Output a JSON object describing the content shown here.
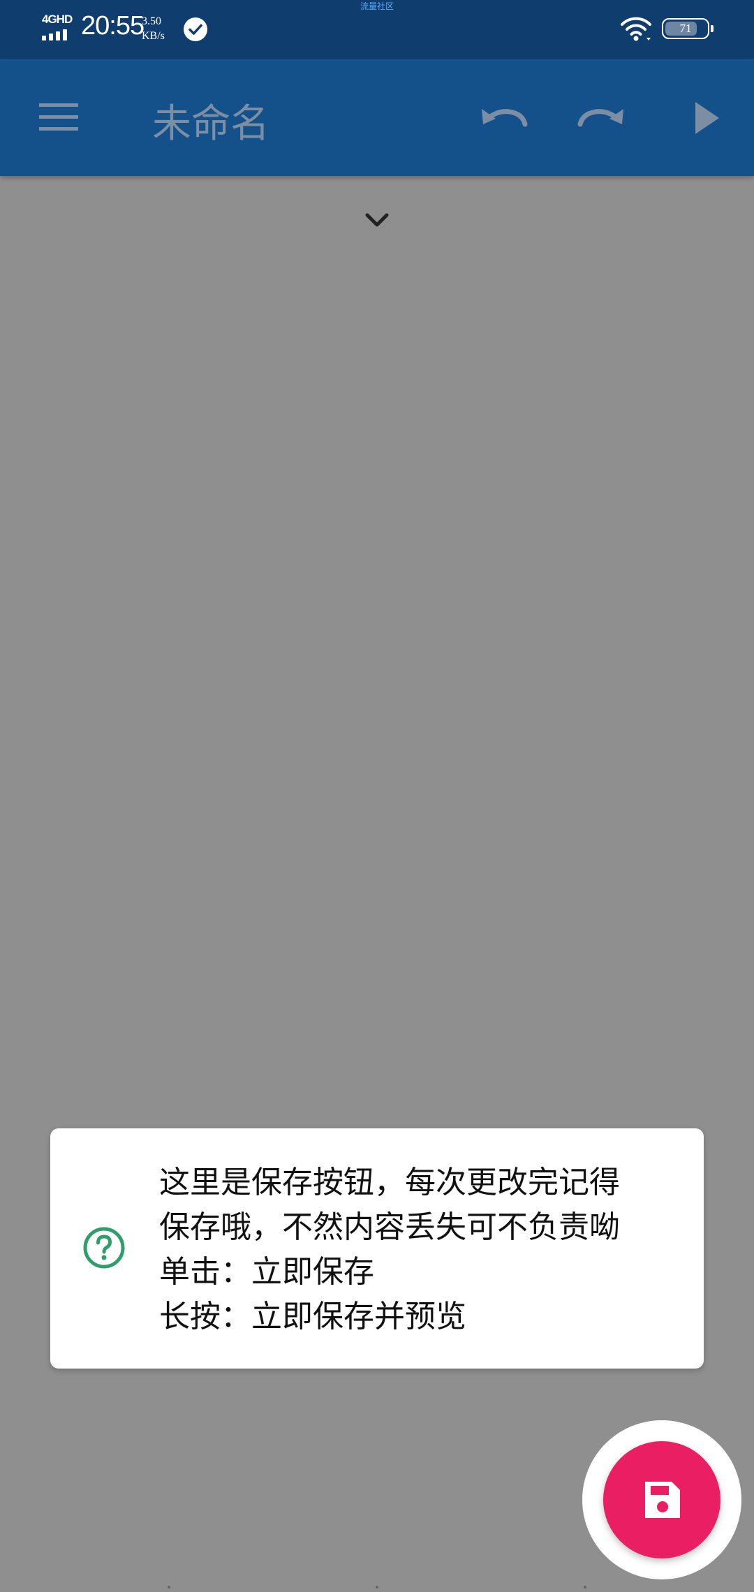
{
  "status_bar": {
    "notice": "流量社区",
    "network": "4GHD",
    "time": "20:55",
    "speed_value": "3.50",
    "speed_unit": "KB/s",
    "battery": "71"
  },
  "app_bar": {
    "title": "未命名"
  },
  "tooltip": {
    "lines": [
      "这里是保存按钮，每次更改完记得",
      "保存哦，不然内容丢失可不负责呦",
      "单击：立即保存",
      "长按：立即保存并预览"
    ]
  },
  "colors": {
    "status_bar": "#0f3d6e",
    "app_bar": "#14518a",
    "scrim": "#8f8f8f",
    "fab": "#e91e63",
    "help_icon": "#2e9e6b"
  },
  "icons": {
    "menu": "hamburger-menu-icon",
    "undo": "undo-icon",
    "redo": "redo-icon",
    "run": "play-icon",
    "expand": "chevron-down-icon",
    "help": "question-circle-icon",
    "save": "floppy-disk-icon"
  }
}
